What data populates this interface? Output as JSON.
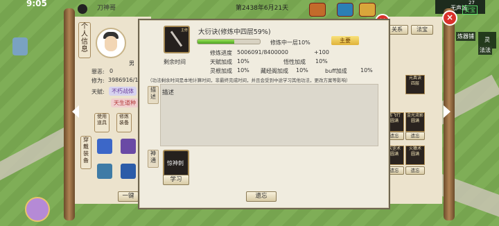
{
  "status": {
    "time": "9:05",
    "game_date": "第2438年6月21天",
    "player_name": "刀神哥"
  },
  "character": {
    "panel_title": "个人信息",
    "gender": "男",
    "crime_label": "罪恶:",
    "crime_value": "0",
    "cultivation_label": "修为:",
    "cultivation_value": "3986916/1",
    "talent_label": "天赋:",
    "talent_tag1": "不朽战体",
    "talent_tag2": "天生道种",
    "tab_use_items": "使用道具",
    "tab_cultivation_equip": "修炼装备",
    "equip_tab": "穿戴装备",
    "onekey_btn": "一键"
  },
  "skill": {
    "icon_label": "主修",
    "title": "大衍诀(修炼中四层59%)",
    "progress": 0.59,
    "stage": "修炼中一层10%",
    "main_badge": "主要",
    "remaining_label": "剩余时间",
    "rows": [
      {
        "label": "修炼进度",
        "value": "5006091/8400000",
        "extra": "+100"
      },
      {
        "label": "天赋加成",
        "value": "10%",
        "label2": "悟性加成",
        "value2": "10%"
      },
      {
        "label": "灵根加成",
        "value": "10%",
        "label2": "藏经阁加成",
        "value2": "10%",
        "label3": "buff加成",
        "value3": "10%"
      }
    ],
    "note": "（功法剩余时间是本地计算时间，非最终完成时间，并且会受到中途学习其他功法，更改方案等影响）",
    "desc_tab": "描述",
    "desc_text": "描述",
    "feat_tab": "神通",
    "feat_name": "惊神刺",
    "learn_btn": "学习",
    "forget_btn": "遗忘"
  },
  "right": {
    "tab1": "关系",
    "tab2": "法宝",
    "slots": [
      {
        "label": "元真诀",
        "sub": "四层"
      },
      {
        "label": "鹏飞行",
        "sub": "圆满"
      },
      {
        "label": "金光流影",
        "sub": "圆满"
      },
      {
        "label": "天罡术",
        "sub": "圆满"
      },
      {
        "label": "火猿术",
        "sub": "圆满"
      }
    ],
    "forget": "遗忘",
    "map_label1": "炼器铺",
    "map_label2": "灵",
    "map_label3": "法法",
    "top_right": "无声城",
    "top_right2": "安宝",
    "top_corner": "27"
  },
  "colors": {
    "accent_red": "#d9312b",
    "gold": "#e0b23a",
    "progress_green": "#4aa51e"
  }
}
